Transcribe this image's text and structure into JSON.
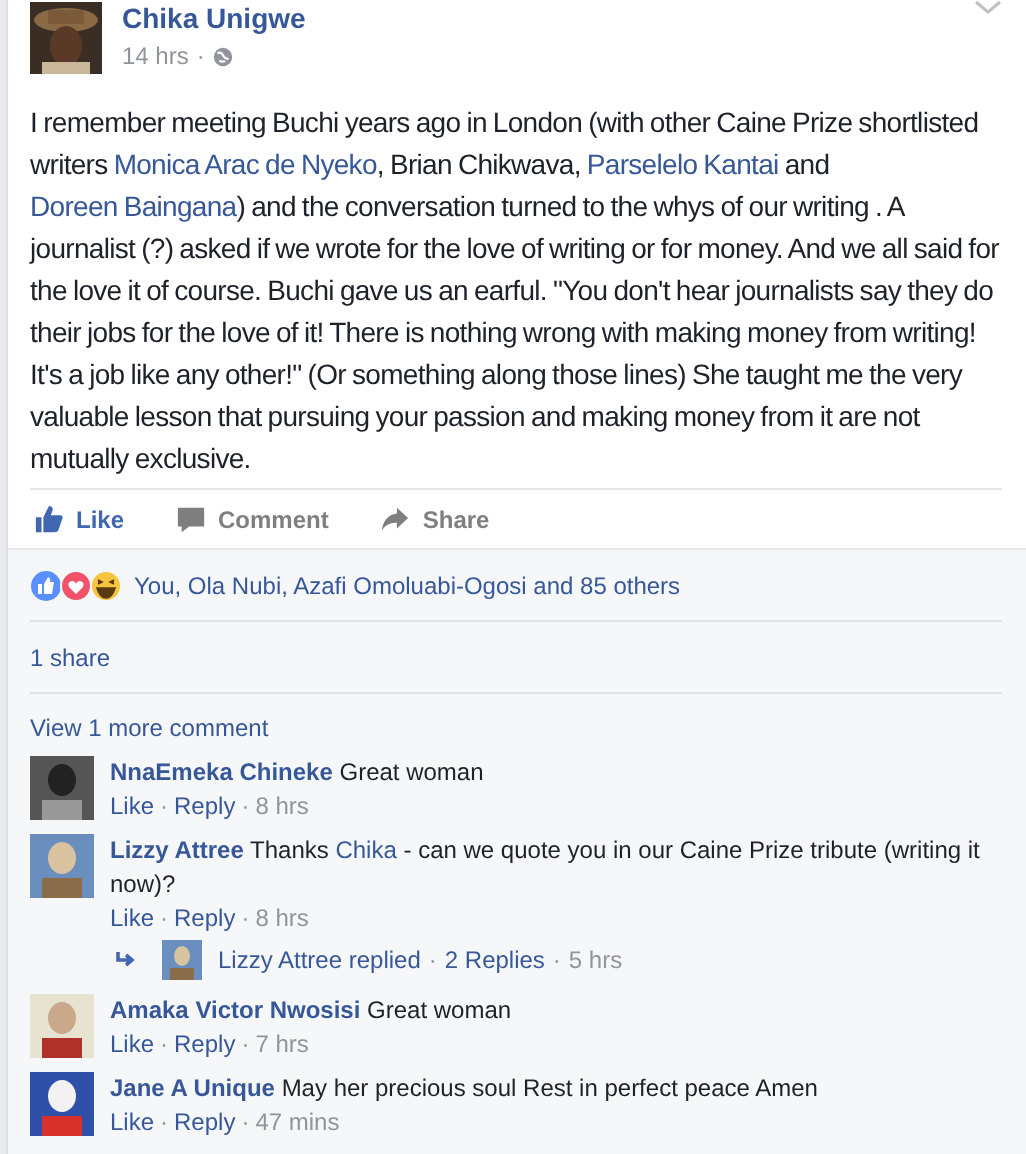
{
  "post": {
    "author": "Chika Unigwe",
    "time": "14 hrs",
    "separator": "·",
    "body": [
      {
        "text": "I remember meeting Buchi years ago in London (with other Caine Prize shortlisted writers ",
        "link": false
      },
      {
        "text": "Monica Arac de Nyeko",
        "link": true
      },
      {
        "text": ", Brian Chikwava, ",
        "link": false
      },
      {
        "text": "Parselelo Kantai",
        "link": true
      },
      {
        "text": " and ",
        "link": false
      },
      {
        "text": "Doreen Baingana",
        "link": true
      },
      {
        "text": ") and the conversation turned to the whys of our writing . A journalist (?) asked if we wrote for the love of writing or for money. And we all said for the love it of course. Buchi gave us an earful. \"You don't hear journalists say they do their jobs for the love of it! There is nothing wrong with making money from writing! It's a job like any other!\" (Or something along those lines) She taught me the very valuable lesson that pursuing your passion and making money from it are not mutually exclusive.",
        "link": false
      }
    ]
  },
  "actions": [
    {
      "kind": "like",
      "label": "Like",
      "selected": true
    },
    {
      "kind": "comment",
      "label": "Comment",
      "selected": false
    },
    {
      "kind": "share",
      "label": "Share",
      "selected": false
    }
  ],
  "reactions": {
    "summary": "You, Ola Nubi, Azafi Omoluabi-Ogosi and 85 others"
  },
  "shares": "1 share",
  "view_more": "View 1 more comment",
  "comments": [
    {
      "author": "NnaEmeka Chineke",
      "text": [
        {
          "text": "Great woman",
          "link": false
        }
      ],
      "meta": [
        {
          "kind": "link",
          "text": "Like"
        },
        {
          "kind": "dot",
          "text": "·"
        },
        {
          "kind": "link",
          "text": "Reply"
        },
        {
          "kind": "dot",
          "text": "·"
        },
        {
          "kind": "time",
          "text": "8 hrs"
        }
      ]
    },
    {
      "author": "Lizzy Attree",
      "text": [
        {
          "text": "Thanks ",
          "link": false
        },
        {
          "text": "Chika",
          "link": true
        },
        {
          "text": " - can we quote you in our Caine Prize tribute (writing it now)?",
          "link": false
        }
      ],
      "meta": [
        {
          "kind": "link",
          "text": "Like"
        },
        {
          "kind": "dot",
          "text": "·"
        },
        {
          "kind": "link",
          "text": "Reply"
        },
        {
          "kind": "dot",
          "text": "·"
        },
        {
          "kind": "time",
          "text": "8 hrs"
        }
      ],
      "replies": [
        {
          "kind": "link",
          "text": "Lizzy Attree replied"
        },
        {
          "kind": "dot",
          "text": "·"
        },
        {
          "kind": "link",
          "text": "2 Replies"
        },
        {
          "kind": "dot",
          "text": "·"
        },
        {
          "kind": "time",
          "text": "5 hrs"
        }
      ]
    },
    {
      "author": "Amaka Victor Nwosisi",
      "text": [
        {
          "text": "Great woman",
          "link": false
        }
      ],
      "meta": [
        {
          "kind": "link",
          "text": "Like"
        },
        {
          "kind": "dot",
          "text": "·"
        },
        {
          "kind": "link",
          "text": "Reply"
        },
        {
          "kind": "dot",
          "text": "·"
        },
        {
          "kind": "time",
          "text": "7 hrs"
        }
      ]
    },
    {
      "author": "Jane A Unique",
      "text": [
        {
          "text": "May her precious soul Rest in perfect peace Amen",
          "link": false
        }
      ],
      "meta": [
        {
          "kind": "link",
          "text": "Like"
        },
        {
          "kind": "dot",
          "text": "·"
        },
        {
          "kind": "link",
          "text": "Reply"
        },
        {
          "kind": "dot",
          "text": "·"
        },
        {
          "kind": "time",
          "text": "47 mins"
        }
      ]
    }
  ]
}
